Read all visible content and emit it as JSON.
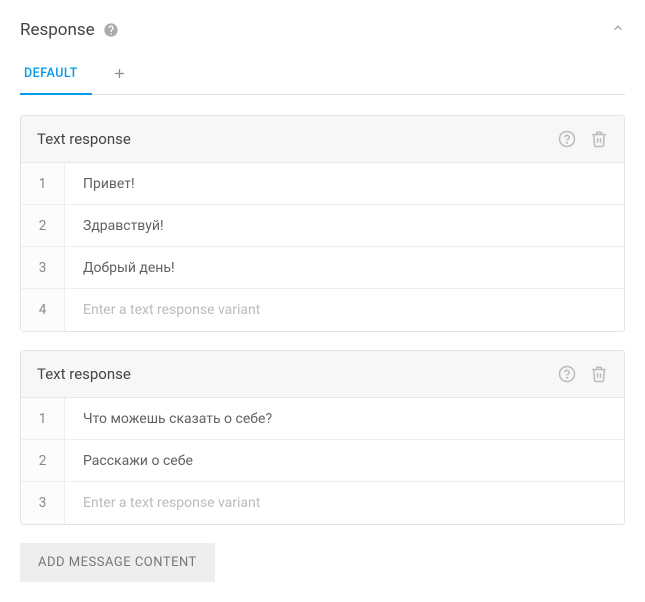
{
  "header": {
    "title": "Response"
  },
  "tabs": {
    "active": "DEFAULT"
  },
  "cards": [
    {
      "title": "Text response",
      "rows": [
        {
          "num": "1",
          "text": "Привет!"
        },
        {
          "num": "2",
          "text": "Здравствуй!"
        },
        {
          "num": "3",
          "text": "Добрый день!"
        }
      ],
      "placeholder_num": "4",
      "placeholder": "Enter a text response variant"
    },
    {
      "title": "Text response",
      "rows": [
        {
          "num": "1",
          "text": "Что можешь сказать о себе?"
        },
        {
          "num": "2",
          "text": "Расскажи о себе"
        }
      ],
      "placeholder_num": "3",
      "placeholder": "Enter a text response variant"
    }
  ],
  "add_button": "ADD MESSAGE CONTENT"
}
